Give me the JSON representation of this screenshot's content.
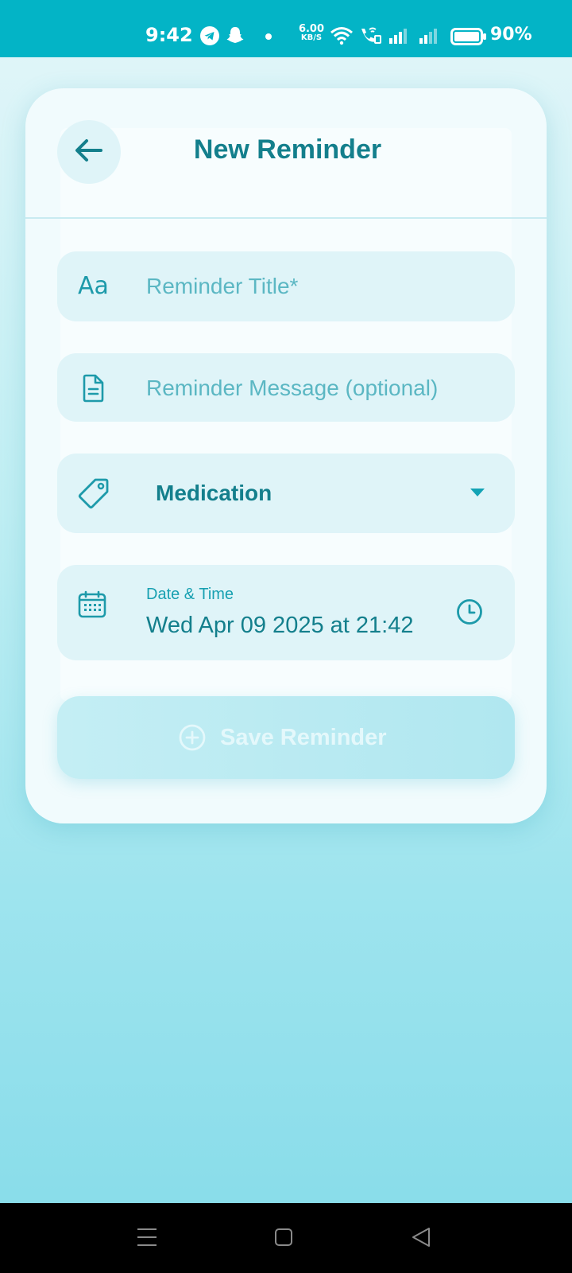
{
  "status_bar": {
    "time": "9:42",
    "net_speed_value": "6.00",
    "net_speed_unit": "KB/S",
    "battery": "90%",
    "icons": [
      "telegram-icon",
      "snapchat-icon",
      "dot-icon",
      "wifi-icon",
      "wifi-call-icon",
      "signal-icon",
      "signal-icon",
      "battery-icon"
    ]
  },
  "header": {
    "title": "New Reminder",
    "back_icon": "arrow-left-icon"
  },
  "form": {
    "title_field": {
      "icon": "text-aa-icon",
      "icon_text": "Aa",
      "placeholder": "Reminder Title*",
      "value": ""
    },
    "message_field": {
      "icon": "document-icon",
      "placeholder": "Reminder Message (optional)",
      "value": ""
    },
    "category_field": {
      "icon": "tag-icon",
      "value": "Medication",
      "caret_icon": "caret-down-icon"
    },
    "datetime_field": {
      "icon": "calendar-icon",
      "label": "Date & Time",
      "value": "Wed Apr 09 2025 at 21:42",
      "clock_icon": "clock-icon"
    },
    "save_button": {
      "label": "Save Reminder",
      "icon": "plus-circle-icon",
      "enabled": false
    }
  },
  "colors": {
    "accent": "#137f8c",
    "status_bar": "#03b4c6",
    "field_bg": "#dff4f8",
    "card_bg": "#f1fbfd"
  },
  "nav_bar": {
    "icons": [
      "menu-icon",
      "home-icon",
      "back-icon"
    ]
  }
}
